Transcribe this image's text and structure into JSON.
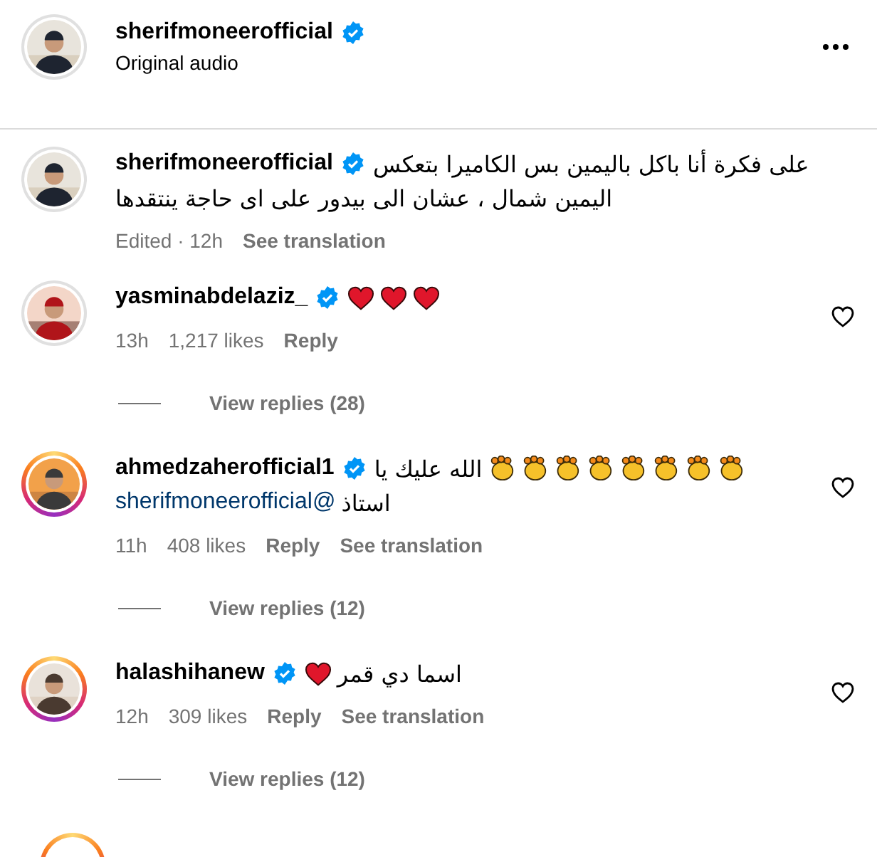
{
  "header": {
    "username": "sherifmoneerofficial",
    "verified": true,
    "subtitle": "Original audio",
    "avatar": {
      "story_ring": false
    }
  },
  "caption": {
    "username": "sherifmoneerofficial",
    "verified": true,
    "avatar": {
      "story_ring": false
    },
    "lines": [
      [
        {
          "kind": "text",
          "text": "على فكرة أنا باكل باليمين بس الكاميرا بتعكس"
        }
      ],
      [
        {
          "kind": "text",
          "text": "اليمين شمال ، عشان الى بيدور على اى حاجة ينتقدها"
        }
      ]
    ],
    "meta": [
      {
        "kind": "info",
        "text": "Edited · 12h"
      },
      {
        "kind": "link",
        "text": "See translation"
      }
    ]
  },
  "comments": [
    {
      "username": "yasminabdelaziz_",
      "verified": true,
      "avatar": {
        "story_ring": false
      },
      "lines": [
        [
          {
            "kind": "heart"
          },
          {
            "kind": "heart"
          },
          {
            "kind": "heart"
          }
        ]
      ],
      "meta": [
        {
          "kind": "info",
          "text": "13h"
        },
        {
          "kind": "info",
          "text": "1,217 likes"
        },
        {
          "kind": "link",
          "text": "Reply"
        }
      ],
      "replies": "View replies (28)",
      "liked": false
    },
    {
      "username": "ahmedzaherofficial1",
      "verified": true,
      "avatar": {
        "story_ring": true
      },
      "lines": [
        [
          {
            "kind": "text",
            "text": "الله عليك يا"
          },
          {
            "kind": "clap"
          },
          {
            "kind": "clap"
          },
          {
            "kind": "clap"
          },
          {
            "kind": "clap"
          },
          {
            "kind": "clap"
          },
          {
            "kind": "clap"
          },
          {
            "kind": "clap"
          },
          {
            "kind": "clap"
          }
        ],
        [
          {
            "kind": "mention",
            "text": "sherifmoneerofficial@"
          },
          {
            "kind": "text",
            "text": "استاذ"
          }
        ]
      ],
      "meta": [
        {
          "kind": "info",
          "text": "11h"
        },
        {
          "kind": "info",
          "text": "408 likes"
        },
        {
          "kind": "link",
          "text": "Reply"
        },
        {
          "kind": "link",
          "text": "See translation"
        }
      ],
      "replies": "View replies (12)",
      "liked": false
    },
    {
      "username": "halashihanew",
      "verified": true,
      "avatar": {
        "story_ring": true
      },
      "lines": [
        [
          {
            "kind": "heart"
          },
          {
            "kind": "text",
            "text": "اسما دي قمر"
          }
        ]
      ],
      "meta": [
        {
          "kind": "info",
          "text": "12h"
        },
        {
          "kind": "info",
          "text": "309 likes"
        },
        {
          "kind": "link",
          "text": "Reply"
        },
        {
          "kind": "link",
          "text": "See translation"
        }
      ],
      "replies": "View replies (12)",
      "liked": false
    }
  ],
  "next_avatar": {
    "story_ring": true
  }
}
